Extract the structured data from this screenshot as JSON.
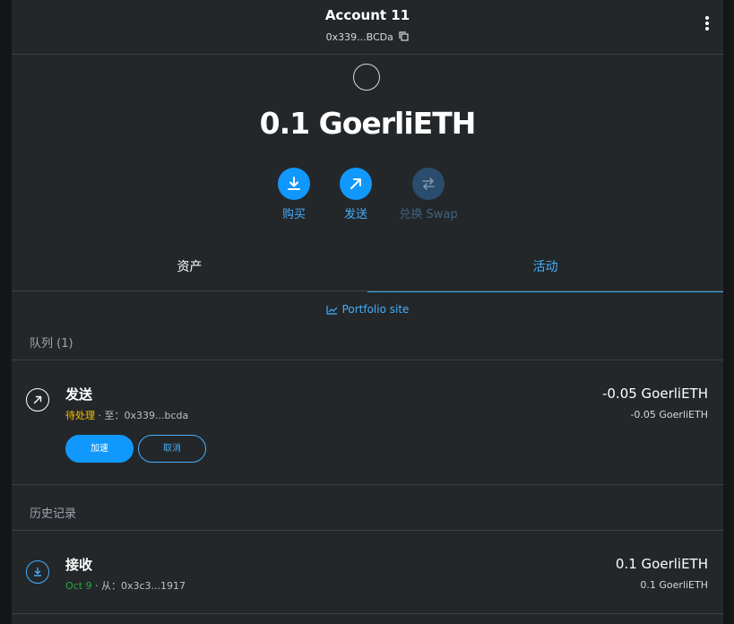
{
  "header": {
    "account_name": "Account 11",
    "address": "0x339...BCDa",
    "copy_icon": "copy-icon",
    "menu_icon": "kebab-menu-icon"
  },
  "balance": {
    "amount": "0.1 GoerliETH"
  },
  "actions": [
    {
      "label": "购买",
      "icon": "download-icon",
      "enabled": true
    },
    {
      "label": "发送",
      "icon": "arrow-up-right-icon",
      "enabled": true
    },
    {
      "label": "兑换 Swap",
      "icon": "swap-icon",
      "enabled": false
    }
  ],
  "tabs": [
    {
      "label": "资产",
      "active": false
    },
    {
      "label": "活动",
      "active": true
    }
  ],
  "portfolio": {
    "label": "Portfolio site",
    "icon": "chart-icon"
  },
  "queue": {
    "header": "队列 (1)",
    "items": [
      {
        "title": "发送",
        "status": "待处理",
        "separator": " · 至：0x339...bcda",
        "amount_primary": "-0.05 GoerliETH",
        "amount_secondary": "-0.05 GoerliETH",
        "speed_up_label": "加速",
        "cancel_label": "取消"
      }
    ]
  },
  "history": {
    "header": "历史记录",
    "items": [
      {
        "title": "接收",
        "date": "Oct 9",
        "separator": " · 从：0x3c3...1917",
        "amount_primary": "0.1 GoerliETH",
        "amount_secondary": "0.1 GoerliETH"
      }
    ]
  },
  "colors": {
    "accent": "#43aefc",
    "button_primary": "#1098fc",
    "pending": "#f8c000",
    "success": "#28a745",
    "background": "#24272a"
  }
}
